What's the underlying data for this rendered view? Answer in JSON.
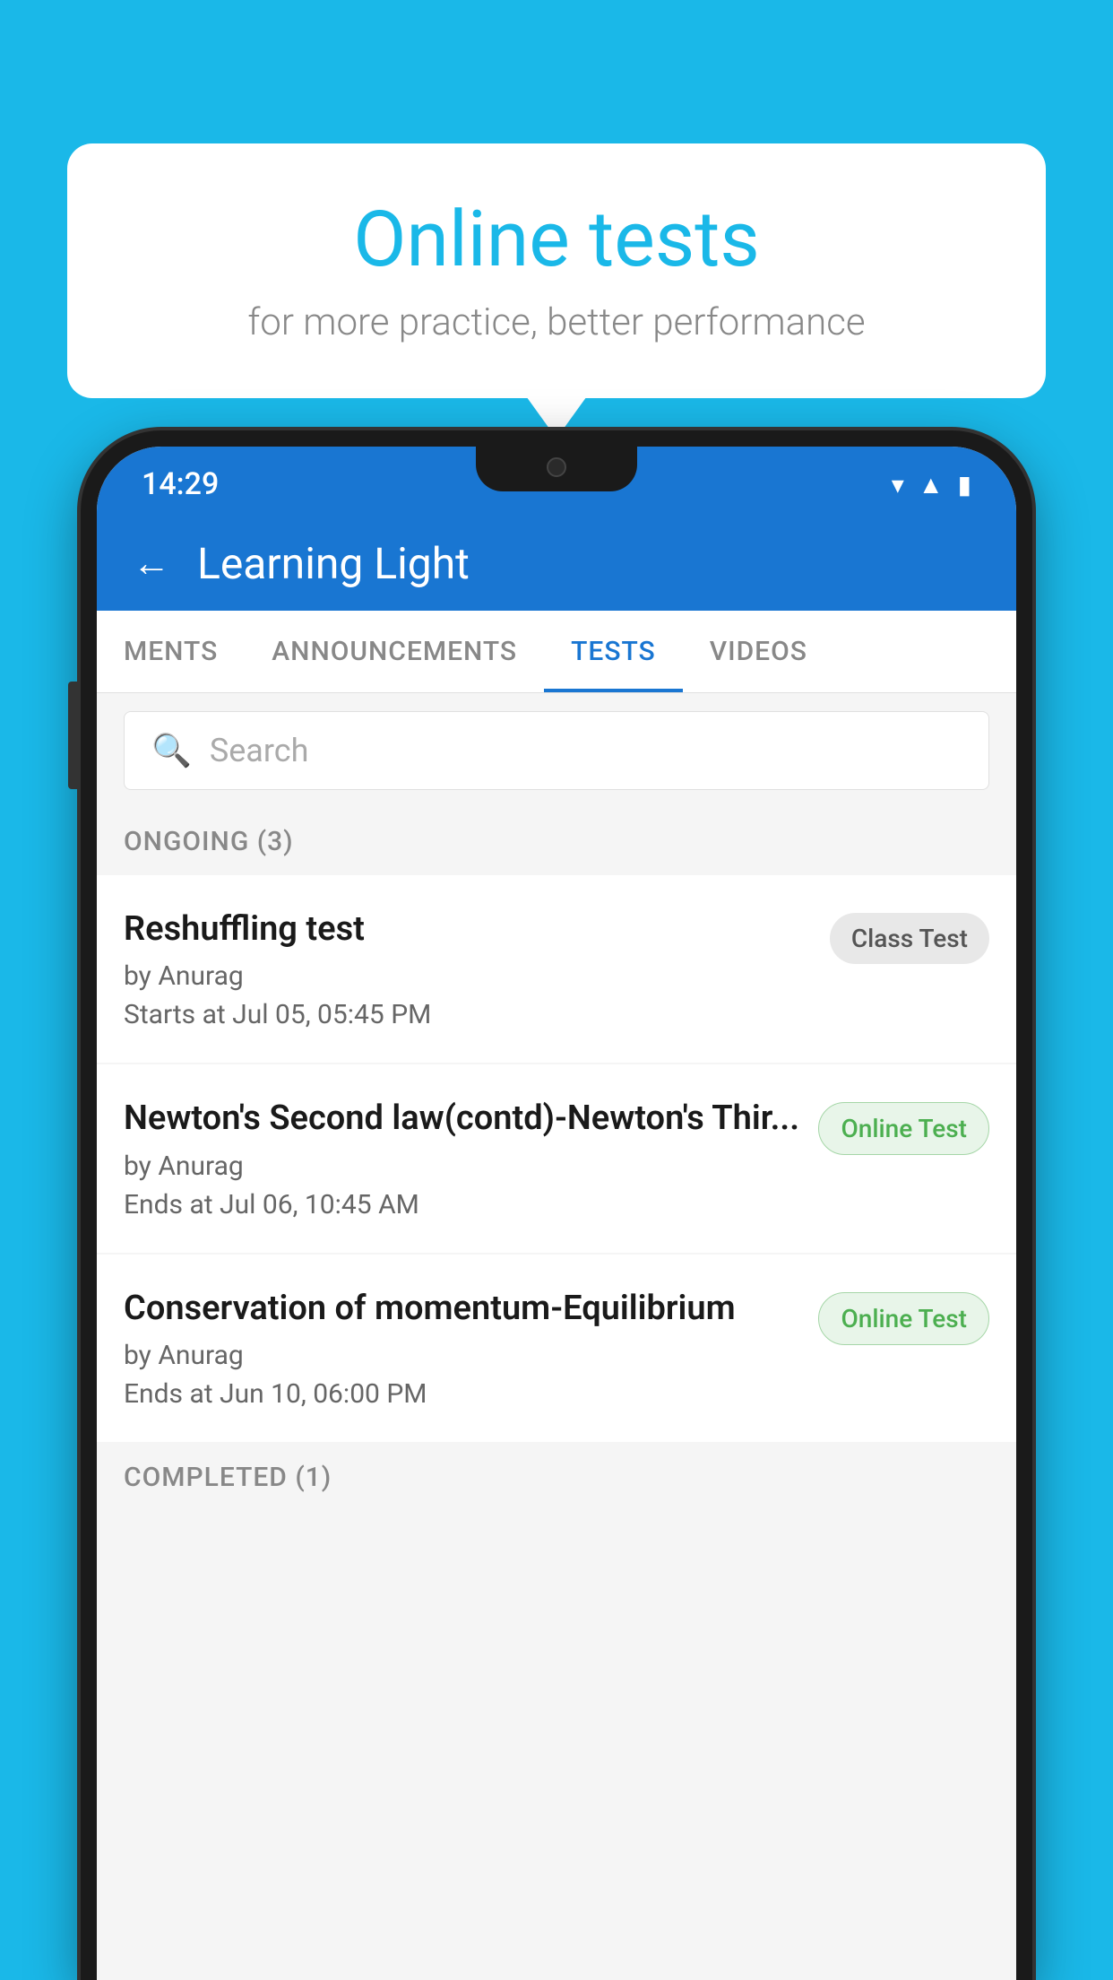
{
  "background_color": "#1ab8e8",
  "bubble": {
    "title": "Online tests",
    "subtitle": "for more practice, better performance"
  },
  "status_bar": {
    "time": "14:29",
    "icons": [
      "wifi",
      "signal",
      "battery"
    ]
  },
  "header": {
    "back_label": "←",
    "title": "Learning Light"
  },
  "tabs": [
    {
      "label": "MENTS",
      "active": false
    },
    {
      "label": "ANNOUNCEMENTS",
      "active": false
    },
    {
      "label": "TESTS",
      "active": true
    },
    {
      "label": "VIDEOS",
      "active": false
    }
  ],
  "search": {
    "placeholder": "Search"
  },
  "ongoing_section": {
    "title": "ONGOING (3)",
    "tests": [
      {
        "name": "Reshuffling test",
        "author": "by Anurag",
        "date": "Starts at  Jul 05, 05:45 PM",
        "badge": "Class Test",
        "badge_type": "class"
      },
      {
        "name": "Newton's Second law(contd)-Newton's Thir...",
        "author": "by Anurag",
        "date": "Ends at  Jul 06, 10:45 AM",
        "badge": "Online Test",
        "badge_type": "online"
      },
      {
        "name": "Conservation of momentum-Equilibrium",
        "author": "by Anurag",
        "date": "Ends at  Jun 10, 06:00 PM",
        "badge": "Online Test",
        "badge_type": "online"
      }
    ]
  },
  "completed_section": {
    "title": "COMPLETED (1)"
  }
}
